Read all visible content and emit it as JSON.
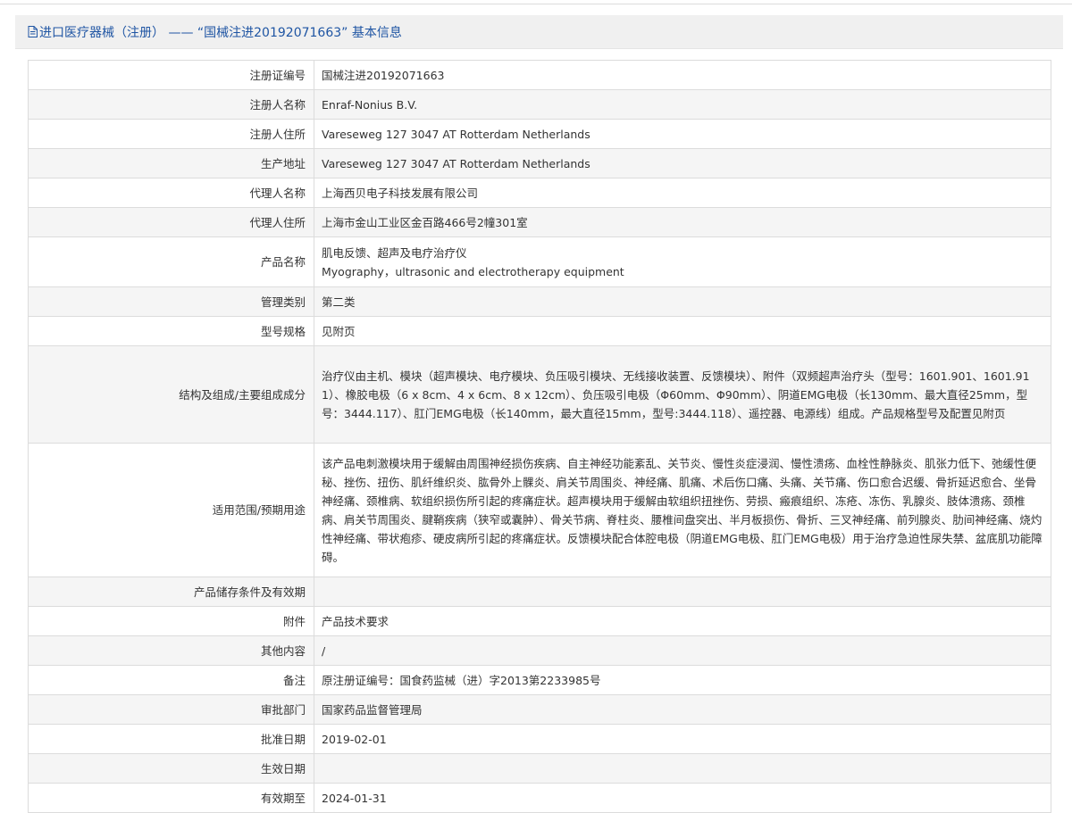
{
  "header": {
    "title": "进口医疗器械（注册） —— “国械注进20192071663” 基本信息"
  },
  "rows": [
    {
      "label": "注册证编号",
      "value": "国械注进20192071663"
    },
    {
      "label": "注册人名称",
      "value": "Enraf-Nonius B.V."
    },
    {
      "label": "注册人住所",
      "value": "Vareseweg 127 3047 AT Rotterdam Netherlands"
    },
    {
      "label": "生产地址",
      "value": "Vareseweg 127 3047 AT Rotterdam Netherlands"
    },
    {
      "label": "代理人名称",
      "value": "上海西贝电子科技发展有限公司"
    },
    {
      "label": "代理人住所",
      "value": "上海市金山工业区金百路466号2幢301室"
    },
    {
      "label": "产品名称",
      "value_cn": "肌电反馈、超声及电疗治疗仪",
      "value_en": "Myography，ultrasonic and electrotherapy equipment"
    },
    {
      "label": "管理类别",
      "value": "第二类"
    },
    {
      "label": "型号规格",
      "value": "见附页"
    },
    {
      "label": "结构及组成/主要组成成分",
      "value": "治疗仪由主机、模块（超声模块、电疗模块、负压吸引模块、无线接收装置、反馈模块）、附件（双频超声治疗头（型号：1601.901、1601.911）、橡胶电极（6 x 8cm、4 x 6cm、8 x 12cm）、负压吸引电极（Φ60mm、Φ90mm）、阴道EMG电极（长130mm、最大直径25mm，型号：3444.117）、肛门EMG电极（长140mm，最大直径15mm，型号:3444.118）、遥控器、电源线）组成。产品规格型号及配置见附页"
    },
    {
      "label": "适用范围/预期用途",
      "value": "该产品电刺激模块用于缓解由周围神经损伤疾病、自主神经功能紊乱、关节炎、慢性炎症浸润、慢性溃疡、血栓性静脉炎、肌张力低下、弛缓性便秘、挫伤、扭伤、肌纤维织炎、肱骨外上髁炎、肩关节周围炎、神经痛、肌痛、术后伤口痛、头痛、关节痛、伤口愈合迟缓、骨折延迟愈合、坐骨神经痛、颈椎病、软组织损伤所引起的疼痛症状。超声模块用于缓解由软组织扭挫伤、劳损、瘢痕组织、冻疮、冻伤、乳腺炎、肢体溃疡、颈椎病、肩关节周围炎、腱鞘疾病（狭窄或囊肿）、骨关节病、脊柱炎、腰椎间盘突出、半月板损伤、骨折、三叉神经痛、前列腺炎、肋间神经痛、烧灼性神经痛、带状疱疹、硬皮病所引起的疼痛症状。反馈模块配合体腔电极（阴道EMG电极、肛门EMG电极）用于治疗急迫性尿失禁、盆底肌功能障碍。"
    },
    {
      "label": "产品储存条件及有效期",
      "value": ""
    },
    {
      "label": "附件",
      "value": "产品技术要求"
    },
    {
      "label": "其他内容",
      "value": "/"
    },
    {
      "label": "备注",
      "value": "原注册证编号：国食药监械（进）字2013第2233985号"
    },
    {
      "label": "审批部门",
      "value": "国家药品监督管理局"
    },
    {
      "label": "批准日期",
      "value": "2019-02-01"
    },
    {
      "label": "生效日期",
      "value": ""
    },
    {
      "label": "有效期至",
      "value": "2024-01-31"
    }
  ]
}
